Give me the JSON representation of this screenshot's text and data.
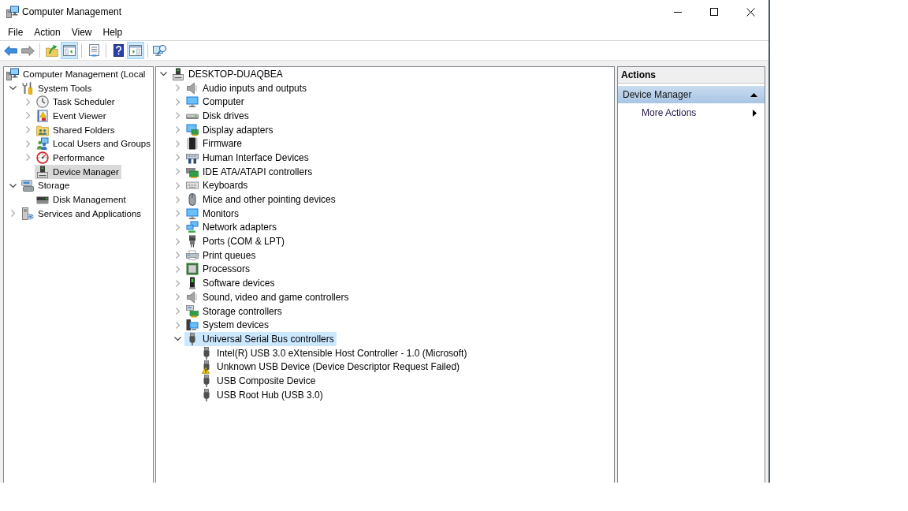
{
  "window": {
    "title": "Computer Management"
  },
  "menu": [
    "File",
    "Action",
    "View",
    "Help"
  ],
  "toolbar": {
    "back_disabled": false,
    "forward_disabled": true,
    "console_tree_shown": true,
    "action_pane_shown": true
  },
  "console_tree": {
    "focused": false,
    "items": [
      {
        "label": "Computer Management (Local",
        "kind": "mmc",
        "selected": false,
        "children": [
          {
            "label": "System Tools",
            "kind": "tools",
            "expanded": true,
            "selected": false,
            "children": [
              {
                "label": "Task Scheduler",
                "kind": "clock",
                "expanded": false,
                "selected": false
              },
              {
                "label": "Event Viewer",
                "kind": "eventlog",
                "expanded": false,
                "selected": false
              },
              {
                "label": "Shared Folders",
                "kind": "sharedfolder",
                "expanded": false,
                "selected": false
              },
              {
                "label": "Local Users and Groups",
                "kind": "users",
                "expanded": false,
                "selected": false
              },
              {
                "label": "Performance",
                "kind": "performance",
                "expanded": false,
                "selected": false
              },
              {
                "label": "Device Manager",
                "kind": "devmgr",
                "selected": true
              }
            ]
          },
          {
            "label": "Storage",
            "kind": "storage",
            "expanded": true,
            "selected": false,
            "children": [
              {
                "label": "Disk Management",
                "kind": "diskmgmt",
                "selected": false
              }
            ]
          },
          {
            "label": "Services and Applications",
            "kind": "services",
            "expanded": false,
            "selected": false
          }
        ]
      }
    ]
  },
  "device_tree": {
    "focused": true,
    "items": [
      {
        "label": "DESKTOP-DUAQBEA",
        "kind": "devmgr",
        "expanded": true,
        "selected": false,
        "problem": false,
        "children": [
          {
            "label": "Audio inputs and outputs",
            "kind": "audio",
            "expanded": false,
            "selected": false,
            "problem": false
          },
          {
            "label": "Computer",
            "kind": "monitor",
            "expanded": false,
            "selected": false,
            "problem": false
          },
          {
            "label": "Disk drives",
            "kind": "disk",
            "expanded": false,
            "selected": false,
            "problem": false
          },
          {
            "label": "Display adapters",
            "kind": "display",
            "expanded": false,
            "selected": false,
            "problem": false
          },
          {
            "label": "Firmware",
            "kind": "firmware",
            "expanded": false,
            "selected": false,
            "problem": false
          },
          {
            "label": "Human Interface Devices",
            "kind": "hid",
            "expanded": false,
            "selected": false,
            "problem": false
          },
          {
            "label": "IDE ATA/ATAPI controllers",
            "kind": "ide",
            "expanded": false,
            "selected": false,
            "problem": false
          },
          {
            "label": "Keyboards",
            "kind": "keyboard",
            "expanded": false,
            "selected": false,
            "problem": false
          },
          {
            "label": "Mice and other pointing devices",
            "kind": "mouse",
            "expanded": false,
            "selected": false,
            "problem": false
          },
          {
            "label": "Monitors",
            "kind": "monitor",
            "expanded": false,
            "selected": false,
            "problem": false
          },
          {
            "label": "Network adapters",
            "kind": "network",
            "expanded": false,
            "selected": false,
            "problem": false
          },
          {
            "label": "Ports (COM & LPT)",
            "kind": "ports",
            "expanded": false,
            "selected": false,
            "problem": false
          },
          {
            "label": "Print queues",
            "kind": "printer",
            "expanded": false,
            "selected": false,
            "problem": false
          },
          {
            "label": "Processors",
            "kind": "processor",
            "expanded": false,
            "selected": false,
            "problem": false
          },
          {
            "label": "Software devices",
            "kind": "software",
            "expanded": false,
            "selected": false,
            "problem": false
          },
          {
            "label": "Sound, video and game controllers",
            "kind": "audio",
            "expanded": false,
            "selected": false,
            "problem": false
          },
          {
            "label": "Storage controllers",
            "kind": "storagectl",
            "expanded": false,
            "selected": false,
            "problem": false
          },
          {
            "label": "System devices",
            "kind": "system",
            "expanded": false,
            "selected": false,
            "problem": false
          },
          {
            "label": "Universal Serial Bus controllers",
            "kind": "usb",
            "expanded": true,
            "selected": true,
            "problem": false,
            "children": [
              {
                "label": "Intel(R) USB 3.0 eXtensible Host Controller - 1.0 (Microsoft)",
                "kind": "usb",
                "selected": false,
                "problem": false
              },
              {
                "label": "Unknown USB Device (Device Descriptor Request Failed)",
                "kind": "usb",
                "selected": false,
                "problem": true
              },
              {
                "label": "USB Composite Device",
                "kind": "usb",
                "selected": false,
                "problem": false
              },
              {
                "label": "USB Root Hub (USB 3.0)",
                "kind": "usb",
                "selected": false,
                "problem": false
              }
            ]
          }
        ]
      }
    ]
  },
  "actions": {
    "title": "Actions",
    "groups": [
      {
        "label": "Device Manager",
        "expanded": true,
        "items": [
          {
            "label": "More Actions",
            "submenu": true
          }
        ]
      }
    ]
  }
}
